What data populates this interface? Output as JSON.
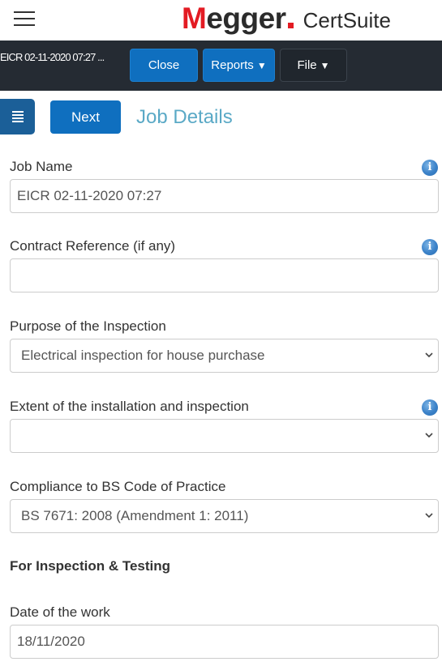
{
  "brand": {
    "logo_first_letter": "M",
    "logo_rest": "egger",
    "product": "CertSuite",
    "accent_red": "#e31b23"
  },
  "toolbar": {
    "job_title": "EICR 02-11-2020 07:27 ...",
    "close_label": "Close",
    "reports_label": "Reports",
    "file_label": "File",
    "caret": "▼"
  },
  "nav": {
    "next_label": "Next",
    "page_title": "Job Details"
  },
  "form": {
    "job_name": {
      "label": "Job Name",
      "value": "EICR 02-11-2020 07:27",
      "has_info": true
    },
    "contract_reference": {
      "label": "Contract Reference (if any)",
      "value": "",
      "has_info": true
    },
    "purpose": {
      "label": "Purpose of the Inspection",
      "selected": "Electrical inspection for house purchase",
      "has_info": false
    },
    "extent": {
      "label": "Extent of the installation and inspection",
      "selected": "",
      "has_info": true
    },
    "compliance": {
      "label": "Compliance to BS Code of Practice",
      "selected": "BS 7671: 2008 (Amendment 1: 2011)",
      "has_info": false
    },
    "section_heading": "For Inspection & Testing",
    "date_of_work": {
      "label": "Date of the work",
      "value": "18/11/2020",
      "has_info": false
    }
  },
  "icons": {
    "info": "i",
    "menu": "hamburger-icon",
    "chevron": "chevron-down-icon"
  },
  "colors": {
    "primary_blue": "#0f6fbf",
    "toolbar_dark": "#252b33",
    "title_teal": "#5aa9c6"
  }
}
